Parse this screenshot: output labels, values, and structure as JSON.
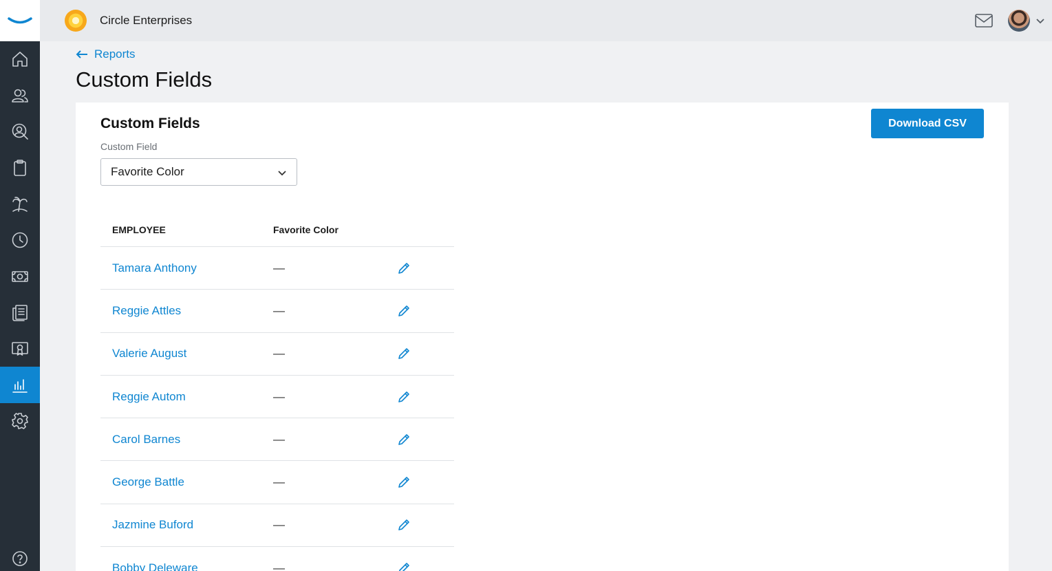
{
  "topbar": {
    "company_name": "Circle Enterprises"
  },
  "sidebar": {
    "items": [
      {
        "icon": "home-icon",
        "active": false
      },
      {
        "icon": "people-icon",
        "active": false
      },
      {
        "icon": "person-search-icon",
        "active": false
      },
      {
        "icon": "clipboard-icon",
        "active": false
      },
      {
        "icon": "palm-tree-icon",
        "active": false
      },
      {
        "icon": "clock-icon",
        "active": false
      },
      {
        "icon": "money-icon",
        "active": false
      },
      {
        "icon": "documents-icon",
        "active": false
      },
      {
        "icon": "certificate-icon",
        "active": false
      },
      {
        "icon": "reports-chart-icon",
        "active": true
      },
      {
        "icon": "gear-icon",
        "active": false
      }
    ],
    "help_icon": "help-icon"
  },
  "breadcrumb": {
    "back_label": "Reports"
  },
  "page": {
    "title": "Custom Fields"
  },
  "card": {
    "title": "Custom Fields",
    "field_label": "Custom Field",
    "selected_field": "Favorite Color",
    "download_label": "Download CSV"
  },
  "table": {
    "headers": [
      "EMPLOYEE",
      "Favorite Color"
    ],
    "rows": [
      {
        "employee": "Tamara Anthony",
        "value": "—"
      },
      {
        "employee": "Reggie Attles",
        "value": "—"
      },
      {
        "employee": "Valerie August",
        "value": "—"
      },
      {
        "employee": "Reggie Autom",
        "value": "—"
      },
      {
        "employee": "Carol Barnes",
        "value": "—"
      },
      {
        "employee": "George Battle",
        "value": "—"
      },
      {
        "employee": "Jazmine Buford",
        "value": "—"
      },
      {
        "employee": "Bobby Deleware",
        "value": "—"
      }
    ]
  },
  "colors": {
    "accent": "#0f86d1",
    "sidebar_bg": "#262f38",
    "topbar_bg": "#e8eaed"
  }
}
